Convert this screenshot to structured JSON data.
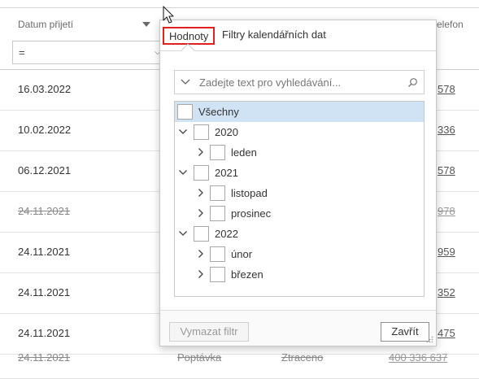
{
  "grid": {
    "header_date": "Datum přijetí",
    "header_phone": "elefon",
    "filter_operator": "=",
    "rows": [
      {
        "date": "16.03.2022",
        "phone": "578",
        "lost": false
      },
      {
        "date": "10.02.2022",
        "phone": "336",
        "lost": false
      },
      {
        "date": "06.12.2021",
        "phone": "578",
        "lost": false
      },
      {
        "date": "24.11.2021",
        "phone": "978",
        "lost": true
      },
      {
        "date": "24.11.2021",
        "phone": "959",
        "lost": false
      },
      {
        "date": "24.11.2021",
        "phone": "352",
        "lost": false
      },
      {
        "date": "24.11.2021",
        "phone": "475",
        "lost": false
      }
    ],
    "last_row": {
      "date": "24.11.2021",
      "type": "Poptávka",
      "status": "Ztraceno",
      "phone": "400 336 637"
    }
  },
  "popup": {
    "tabs": {
      "values": "Hodnoty",
      "date_filters": "Filtry kalendářních dat"
    },
    "search_placeholder": "Zadejte text pro vyhledávání...",
    "tree": [
      {
        "label": "Všechny",
        "level": 0,
        "arrow": "none",
        "selected": true
      },
      {
        "label": "2020",
        "level": 1,
        "arrow": "down"
      },
      {
        "label": "leden",
        "level": 2,
        "arrow": "right"
      },
      {
        "label": "2021",
        "level": 1,
        "arrow": "down"
      },
      {
        "label": "listopad",
        "level": 2,
        "arrow": "right"
      },
      {
        "label": "prosinec",
        "level": 2,
        "arrow": "right"
      },
      {
        "label": "2022",
        "level": 1,
        "arrow": "down"
      },
      {
        "label": "únor",
        "level": 2,
        "arrow": "right"
      },
      {
        "label": "březen",
        "level": 2,
        "arrow": "right"
      }
    ],
    "buttons": {
      "clear": "Vymazat filtr",
      "close": "Zavřít"
    }
  },
  "colors": {
    "active_tab_border": "#e0201c",
    "selection": "#cfe3f5"
  }
}
